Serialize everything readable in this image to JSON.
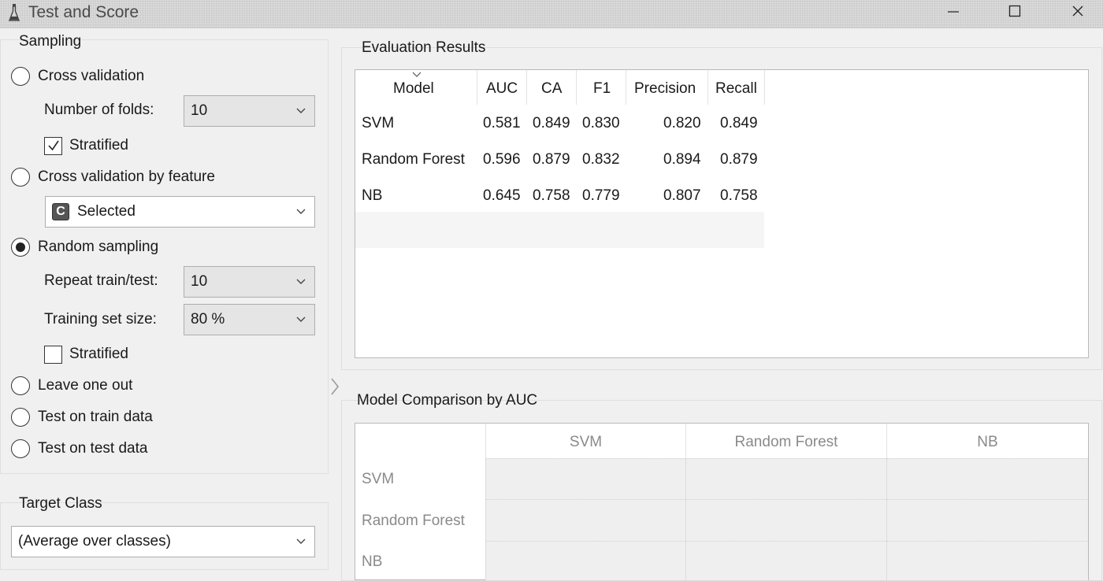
{
  "window": {
    "title": "Test and Score"
  },
  "sampling": {
    "title": "Sampling",
    "cross_validation": {
      "label": "Cross validation",
      "selected": false
    },
    "folds": {
      "label": "Number of folds:",
      "value": "10"
    },
    "stratified_cv": {
      "label": "Stratified",
      "checked": true
    },
    "cv_by_feature": {
      "label": "Cross validation by feature",
      "selected": false
    },
    "feature_select": {
      "badge": "C",
      "value": "Selected"
    },
    "random_sampling": {
      "label": "Random sampling",
      "selected": true
    },
    "repeat": {
      "label": "Repeat train/test:",
      "value": "10"
    },
    "train_size": {
      "label": "Training set size:",
      "value": "80 %"
    },
    "stratified_rs": {
      "label": "Stratified",
      "checked": false
    },
    "leave_one_out": {
      "label": "Leave one out",
      "selected": false
    },
    "test_on_train": {
      "label": "Test on train data",
      "selected": false
    },
    "test_on_test": {
      "label": "Test on test data",
      "selected": false
    }
  },
  "target_class": {
    "title": "Target Class",
    "value": "(Average over classes)"
  },
  "evaluation": {
    "title": "Evaluation Results",
    "columns": [
      "Model",
      "AUC",
      "CA",
      "F1",
      "Precision",
      "Recall"
    ],
    "rows": [
      [
        "SVM",
        "0.581",
        "0.849",
        "0.830",
        "0.820",
        "0.849"
      ],
      [
        "Random Forest",
        "0.596",
        "0.879",
        "0.832",
        "0.894",
        "0.879"
      ],
      [
        "NB",
        "0.645",
        "0.758",
        "0.779",
        "0.807",
        "0.758"
      ]
    ]
  },
  "comparison": {
    "title": "Model Comparison by AUC",
    "columns": [
      "SVM",
      "Random Forest",
      "NB"
    ],
    "rows": [
      "SVM",
      "Random Forest",
      "NB"
    ]
  },
  "icons": {
    "app": "flask-icon",
    "minimize": "minimize-icon",
    "maximize": "maximize-icon",
    "close": "close-icon",
    "dropdown": "chevron-down-icon",
    "sort": "sort-indicator-icon",
    "splitter": "chevron-right-icon"
  },
  "colors": {
    "titlebar": "#dadada",
    "panel": "#f0f0f0",
    "highlight_row": "#f5f5f5",
    "radio_selected": "#222222"
  }
}
